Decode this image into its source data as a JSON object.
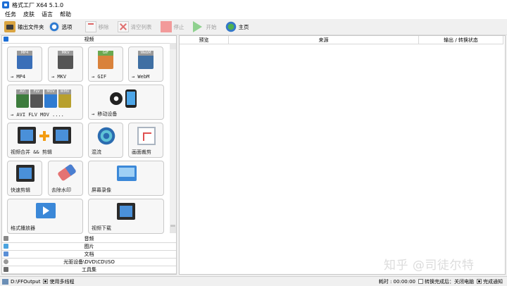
{
  "window": {
    "title": "格式工厂 X64 5.1.0"
  },
  "menu": [
    "任务",
    "皮肤",
    "语言",
    "帮助"
  ],
  "toolbar": {
    "output_folder": "输出文件夹",
    "options": "选项",
    "remove": "移除",
    "clear_list": "清空列表",
    "stop": "停止",
    "start": "开始",
    "home": "主页"
  },
  "left": {
    "video_header": "视频",
    "tiles": {
      "mp4": {
        "label": "→ MP4",
        "badge": "MP4"
      },
      "mkv": {
        "label": "→ MKV",
        "badge": "MKV"
      },
      "gif": {
        "label": "→ GIF",
        "badge": "GIF"
      },
      "webm": {
        "label": "→ WebM",
        "badge": "WebM"
      },
      "multi": {
        "label": "→ AVI FLV MOV ....",
        "badges": [
          "AVI",
          "FLV",
          "MOV",
          "WMV"
        ]
      },
      "mobile": {
        "label": "→ 移动设备"
      },
      "merge": {
        "label": "视频合并 && 剪辑"
      },
      "mix": {
        "label": "混流"
      },
      "crop": {
        "label": "画面裁剪"
      },
      "quickcut": {
        "label": "快速剪辑"
      },
      "watermark": {
        "label": "去除水印"
      },
      "record": {
        "label": "屏幕录像"
      },
      "player": {
        "label": "格式播放器"
      },
      "download": {
        "label": "视频下载"
      }
    },
    "categories": [
      "音频",
      "图片",
      "文档",
      "光驱设备\\DVD\\CD\\ISO",
      "工具集"
    ]
  },
  "table": {
    "columns": [
      "预览",
      "来源",
      "输出 / 转换状态"
    ]
  },
  "watermark_text": "知乎 @司徒尔特",
  "status": {
    "path": "D:\\FFOutput",
    "multithread_label": "使用多线程",
    "elapsed_label": "耗时 : 00:00:00",
    "shutdown_label": "转换完成后：关闭电脑",
    "notify_label": "完成通知"
  }
}
